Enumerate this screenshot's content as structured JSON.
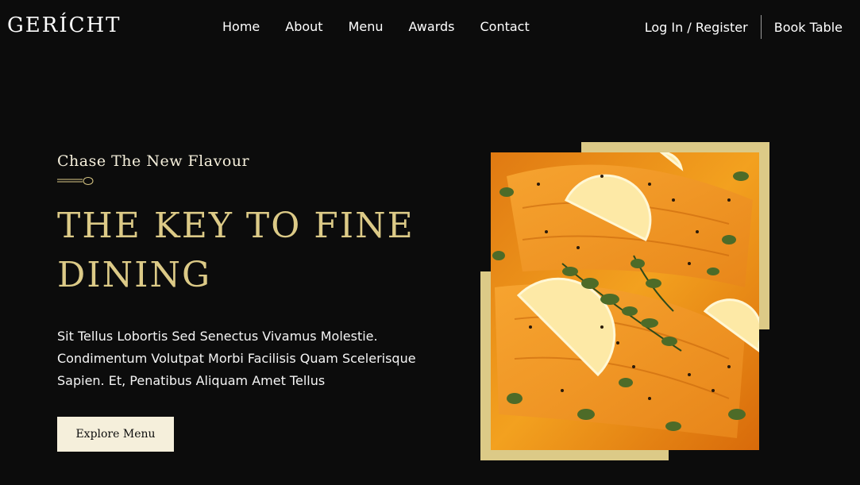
{
  "brand": {
    "logo": "GERÍCHT"
  },
  "nav": {
    "links": [
      "Home",
      "About",
      "Menu",
      "Awards",
      "Contact"
    ],
    "login": "Log In / Register",
    "book": "Book Table"
  },
  "hero": {
    "subtitle": "Chase The New Flavour",
    "title": "THE KEY TO FINE DINING",
    "description": "Sit Tellus Lobortis Sed Senectus Vivamus Molestie. Condimentum Volutpat Morbi Facilisis Quam Scelerisque Sapien. Et, Penatibus Aliquam Amet Tellus",
    "cta": "Explore Menu"
  },
  "colors": {
    "background": "#0c0c0c",
    "gold": "#dcca87",
    "cream": "#f5efdb"
  },
  "icons": {
    "spoon": "spoon-icon"
  }
}
